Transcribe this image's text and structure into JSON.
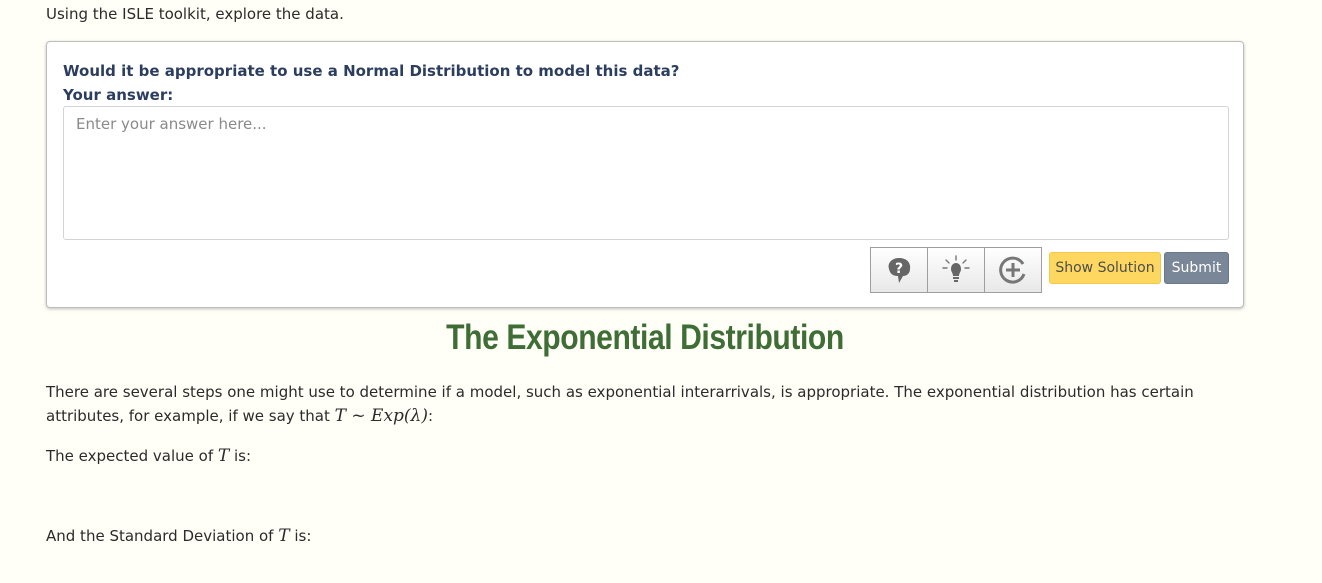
{
  "intro": "Using the ISLE toolkit, explore the data.",
  "question": {
    "text": "Would it be appropriate to use a Normal Distribution to model this data?",
    "answer_label": "Your answer:",
    "answer_placeholder": "Enter your answer here...",
    "answer_value": "",
    "icon_buttons": [
      "brain-question-icon",
      "lightbulb-icon",
      "plus-circle-icon"
    ],
    "show_solution_label": "Show Solution",
    "submit_label": "Submit"
  },
  "section": {
    "title": "The Exponential Distribution",
    "para1_text": "There are several steps one might use to determine if a model, such as exponential interarrivals, is appropriate. The exponential distribution has certain attributes, for example, if we say that",
    "para1_math": "T ~ Exp(λ)",
    "para1_end": ":",
    "para2_text": "The expected value of",
    "para2_math": "T",
    "para2_end": "is:",
    "para3_text": "And the Standard Deviation of",
    "para3_math": "T",
    "para3_end": "is:"
  },
  "colors": {
    "background": "#fffff7",
    "title_green": "#3e6e36",
    "question_navy": "#2c3e5f",
    "show_solution_bg": "#fdd75f",
    "submit_bg": "#7a8799"
  }
}
